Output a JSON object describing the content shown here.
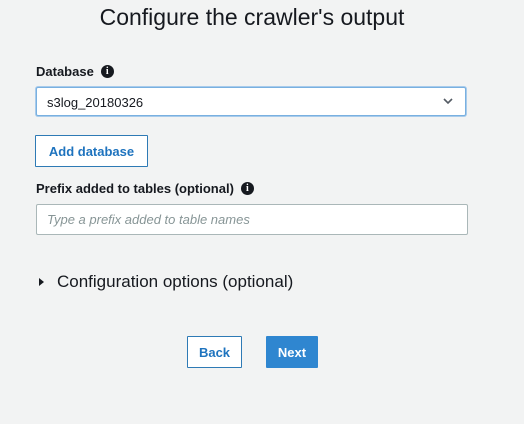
{
  "page": {
    "title": "Configure the crawler's output"
  },
  "database": {
    "label": "Database",
    "selected": "s3log_20180326",
    "info_icon": "info-icon"
  },
  "add_database_button": "Add database",
  "prefix": {
    "label": "Prefix added to tables (optional)",
    "value": "",
    "placeholder": "Type a prefix added to table names",
    "info_icon": "info-icon"
  },
  "configuration_options": {
    "label": "Configuration options (optional)",
    "expanded": false
  },
  "footer": {
    "back_label": "Back",
    "next_label": "Next"
  },
  "colors": {
    "background": "#f2f3f3",
    "primary": "#2f86d0",
    "link": "#1e73be",
    "focus_border": "#79b0e0"
  }
}
